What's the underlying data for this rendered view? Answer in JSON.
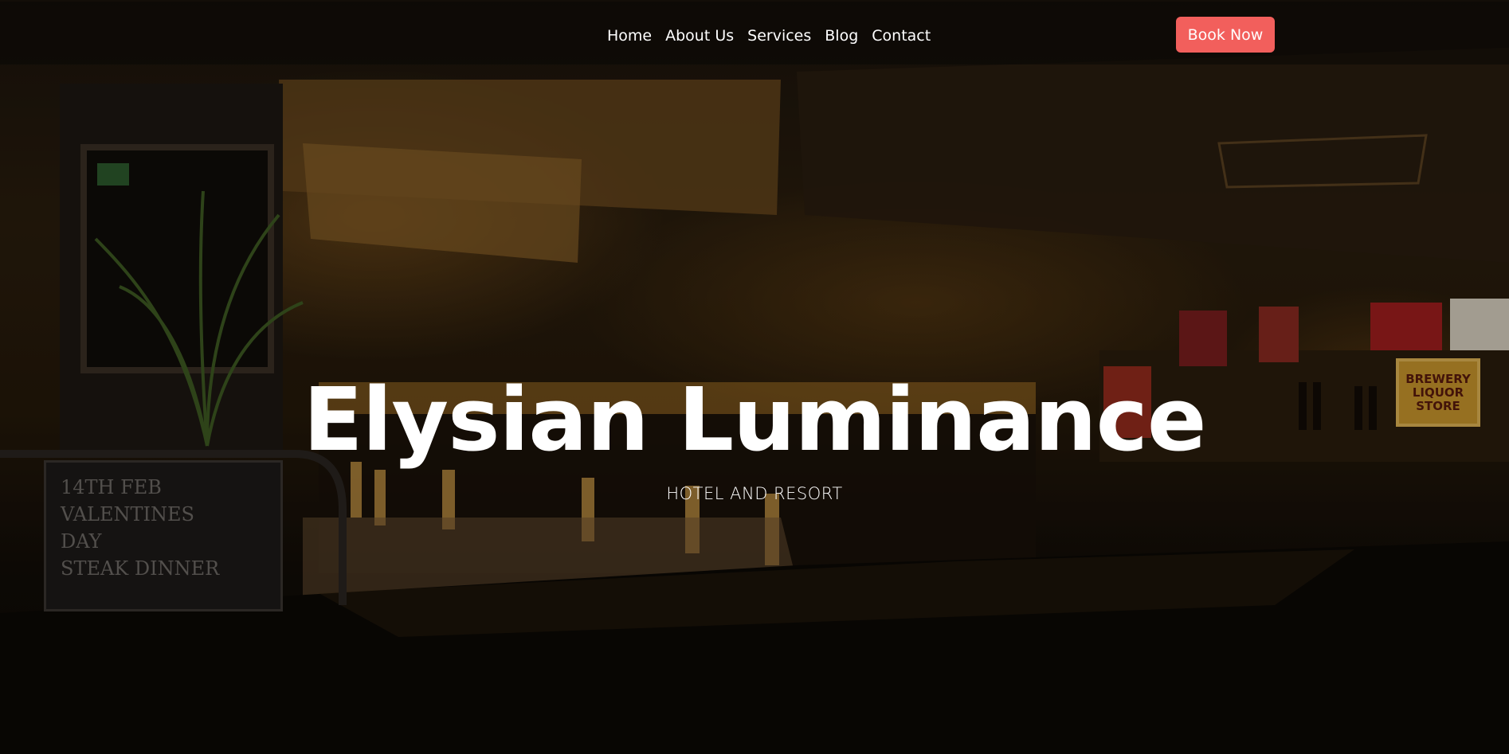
{
  "nav": {
    "links": [
      "Home",
      "About Us",
      "Services",
      "Blog",
      "Contact"
    ],
    "cta_label": "Book Now"
  },
  "hero": {
    "title": "Elysian Luminance",
    "subtitle": "HOTEL AND RESORT",
    "background_description_sign": [
      "BREWERY",
      "LIQUOR",
      "STORE"
    ],
    "chalkboard_text": [
      "14TH FEB",
      "VALENTINES",
      "DAY",
      "STEAK DINNER"
    ]
  },
  "colors": {
    "accent": "#f25f5c",
    "text": "#ffffff",
    "nav_bg": "rgba(10,8,6,0.55)"
  }
}
